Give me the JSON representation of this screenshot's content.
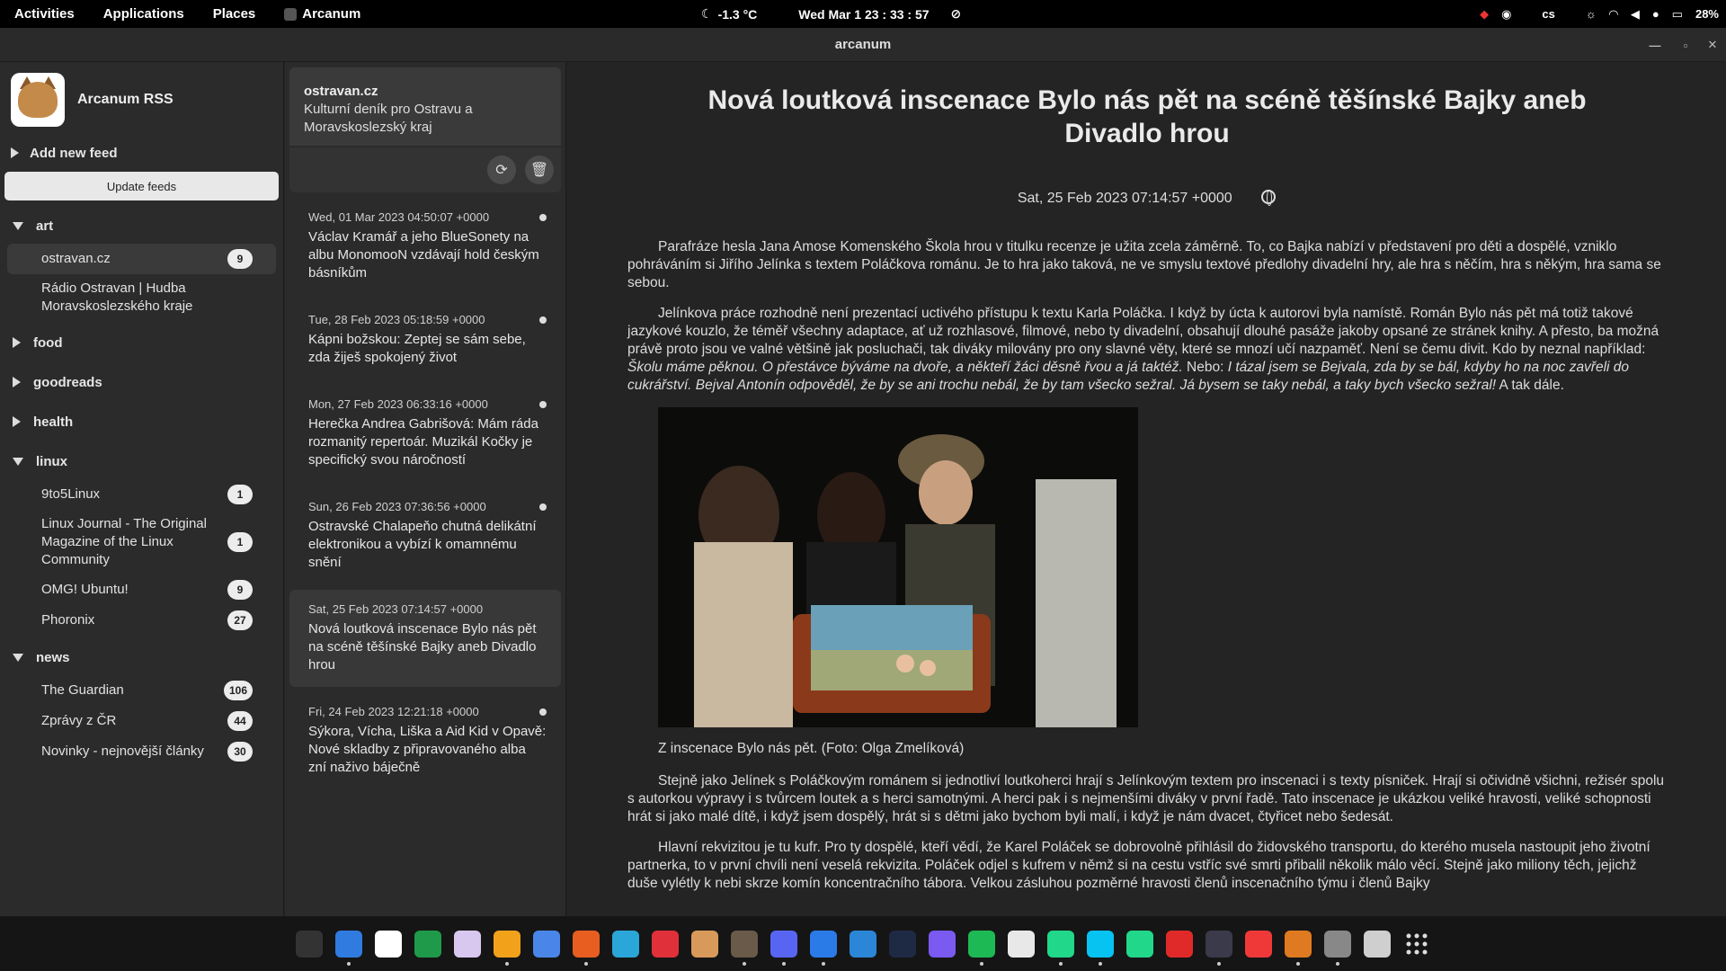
{
  "topbar": {
    "activities": "Activities",
    "applications": "Applications",
    "places": "Places",
    "app": "Arcanum",
    "weather": "-1.3 °C",
    "datetime": "Wed Mar 1  23 : 33 : 57",
    "lang": "cs",
    "battery": "28%"
  },
  "window": {
    "title": "arcanum"
  },
  "sidebar": {
    "app_name": "Arcanum RSS",
    "add_feed": "Add new feed",
    "update_feeds": "Update feeds",
    "categories": [
      {
        "name": "art",
        "expanded": true,
        "feeds": [
          {
            "name": "ostravan.cz",
            "count": "9",
            "selected": true
          },
          {
            "name": "Rádio Ostravan | Hudba Moravskoslezského kraje",
            "count": ""
          }
        ]
      },
      {
        "name": "food",
        "expanded": false,
        "feeds": []
      },
      {
        "name": "goodreads",
        "expanded": false,
        "feeds": []
      },
      {
        "name": "health",
        "expanded": false,
        "feeds": []
      },
      {
        "name": "linux",
        "expanded": true,
        "feeds": [
          {
            "name": "9to5Linux",
            "count": "1"
          },
          {
            "name": "Linux Journal - The Original Magazine of the Linux Community",
            "count": "1"
          },
          {
            "name": "OMG! Ubuntu!",
            "count": "9"
          },
          {
            "name": "Phoronix",
            "count": "27"
          }
        ]
      },
      {
        "name": "news",
        "expanded": true,
        "feeds": [
          {
            "name": "The Guardian",
            "count": "106"
          },
          {
            "name": "Zprávy z ČR",
            "count": "44"
          },
          {
            "name": "Novinky - nejnovější články",
            "count": "30"
          }
        ]
      }
    ]
  },
  "feedcard": {
    "title": "ostravan.cz",
    "description": "Kulturní deník pro Ostravu a Moravskoslezský kraj"
  },
  "entries": [
    {
      "date": "Wed, 01 Mar 2023 04:50:07 +0000",
      "title": "Václav Kramář a jeho BlueSonety na albu MonomooN vzdávají hold českým básníkům",
      "unread": true
    },
    {
      "date": "Tue, 28 Feb 2023 05:18:59 +0000",
      "title": "Kápni božskou: Zeptej se sám sebe, zda žiješ spokojený život",
      "unread": true
    },
    {
      "date": "Mon, 27 Feb 2023 06:33:16 +0000",
      "title": "Herečka Andrea Gabrišová: Mám ráda rozmanitý repertoár. Muzikál Kočky je specifický svou náročností",
      "unread": true
    },
    {
      "date": "Sun, 26 Feb 2023 07:36:56 +0000",
      "title": "Ostravské Chalapeňo chutná delikátní elektronikou a vybízí k omamnému snění",
      "unread": true
    },
    {
      "date": "Sat, 25 Feb 2023 07:14:57 +0000",
      "title": "Nová loutková inscenace Bylo nás pět na scéně těšínské Bajky aneb Divadlo hrou",
      "unread": false,
      "selected": true
    },
    {
      "date": "Fri, 24 Feb 2023 12:21:18 +0000",
      "title": "Sýkora, Vícha, Liška a Aid Kid v Opavě: Nové skladby z připravovaného alba zní naživo báječně",
      "unread": true
    }
  ],
  "article": {
    "title": "Nová loutková inscenace Bylo nás pět na scéně těšínské Bajky aneb Divadlo hrou",
    "date": "Sat, 25 Feb 2023 07:14:57 +0000",
    "p1": "Parafráze hesla Jana Amose Komenského Škola hrou v titulku recenze je užita zcela záměrně. To, co Bajka nabízí v představení pro děti a dospělé, vzniklo pohráváním si Jiřího Jelínka s textem Poláčkova románu. Je to hra jako taková, ne ve smyslu textové předlohy divadelní hry, ale hra s něčím, hra s někým, hra sama se sebou.",
    "p2a": "Jelínkova práce rozhodně není prezentací uctivého přístupu k textu Karla Poláčka. I když by úcta k autorovi byla namístě. Román Bylo nás pět má totiž takové jazykové kouzlo, že téměř všechny adaptace, ať už rozhlasové, filmové, nebo ty divadelní, obsahují dlouhé pasáže jakoby opsané ze stránek knihy. A přesto, ba možná právě proto jsou ve valné většině jak posluchači, tak diváky milovány pro ony slavné věty, které se mnozí učí nazpaměť. Není se čemu divit. Kdo by neznal například: ",
    "p2b": "Školu máme pěknou. O přestávce býváme na dvoře, a někteří žáci děsně řvou a já taktéž.",
    "p2c": " Nebo: ",
    "p2d": "I tázal jsem se Bejvala, zda by se bál, kdyby ho na noc zavřeli do cukrářství. Bejval Antonín odpověděl, že by se ani trochu nebál, že by tam všecko sežral. Já bysem se taky nebál, a taky bych všecko sežral!",
    "p2e": " A tak dále.",
    "caption": "Z inscenace Bylo nás pět. (Foto: Olga Zmelíková)",
    "p3": "Stejně jako Jelínek s Poláčkovým románem si jednotliví loutkoherci hrají s Jelínkovým textem pro inscenaci i s texty písniček. Hrají si očividně všichni, režisér spolu s autorkou výpravy i s tvůrcem loutek a s herci samotnými. A herci pak i s nejmenšími diváky v první řadě. Tato inscenace je ukázkou veliké hravosti, veliké schopnosti hrát si jako malé dítě, i když jsem dospělý, hrát si s dětmi jako bychom byli malí, i když je nám dvacet, čtyřicet nebo šedesát.",
    "p4": "Hlavní rekvizitou je tu kufr. Pro ty dospělé, kteří vědí, že Karel Poláček se dobrovolně přihlásil do židovského transportu, do kterého musela nastoupit jeho životní partnerka, to v první chvíli není veselá rekvizita. Poláček odjel s kufrem v němž si na cestu vstříc své smrti přibalil několik málo věcí. Stejně jako miliony těch, jejichž duše vylétly k nebi skrze komín koncentračního tábora. Velkou zásluhou pozměrné hravosti členů inscenačního týmu i členů Bajky"
  },
  "dock": {
    "icons": [
      "terminal-icon",
      "finder-icon",
      "notion-icon",
      "tasks-icon",
      "notes-icon",
      "brave-icon",
      "chromium-icon",
      "firefox-icon",
      "browser-icon",
      "mailspring-icon",
      "user-icon",
      "arcanum-icon",
      "discord-icon",
      "chat-icon",
      "qbittorrent-icon",
      "settings-icon",
      "proton-icon",
      "spotify-icon",
      "anki-icon",
      "clion-icon",
      "webstorm-icon",
      "pycharm-icon",
      "pdf-icon",
      "vscode-icon",
      "vivaldi-icon",
      "arcanum2-icon",
      "gear-icon",
      "trash-icon",
      "apps-grid-icon"
    ],
    "colors": [
      "#333",
      "#2f7be0",
      "#fff",
      "#1f9a4a",
      "#d8c8f0",
      "#f1a21a",
      "#4a86e8",
      "#e85d20",
      "#2aa7d8",
      "#e0303a",
      "#d89a5a",
      "#6a5a4a",
      "#5865f2",
      "#2a7be8",
      "#2c86d8",
      "#1e2a44",
      "#7a5af0",
      "#1db954",
      "#e8e8e8",
      "#21d789",
      "#07c3f2",
      "#21d789",
      "#e02a2a",
      "#3a3a4a",
      "#ef3939",
      "#e07a20",
      "#888",
      "#cfcfcf",
      "#151515"
    ]
  }
}
